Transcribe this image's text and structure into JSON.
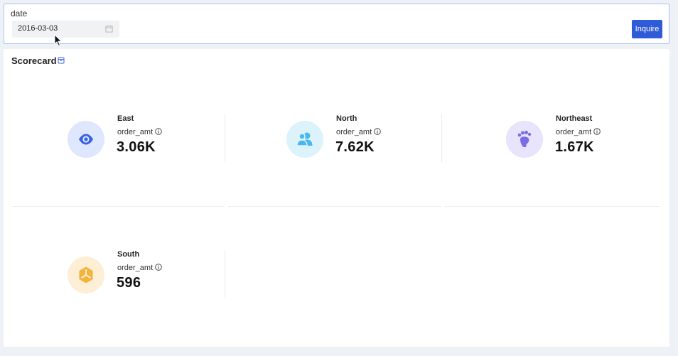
{
  "filter": {
    "label": "date",
    "date_value": "2016-03-03",
    "inquire_label": "Inquire"
  },
  "scorecard": {
    "title": "Scorecard",
    "cards": [
      {
        "region": "East",
        "metric": "order_amt",
        "value": "3.06K",
        "icon": "eye-icon",
        "icon_bg": "#dfe7ff",
        "icon_color": "#3a63e0"
      },
      {
        "region": "North",
        "metric": "order_amt",
        "value": "7.62K",
        "icon": "users-icon",
        "icon_bg": "#ddf3fb",
        "icon_color": "#4ab8ec"
      },
      {
        "region": "Northeast",
        "metric": "order_amt",
        "value": "1.67K",
        "icon": "footprint-icon",
        "icon_bg": "#e7e4fb",
        "icon_color": "#7b6ce6"
      },
      {
        "region": "South",
        "metric": "order_amt",
        "value": "596",
        "icon": "cube-icon",
        "icon_bg": "#fdefd6",
        "icon_color": "#f4b33a"
      }
    ]
  },
  "colors": {
    "accent": "#2e5bd7",
    "filter_border": "#a9c1f2",
    "background": "#eef1f5"
  }
}
